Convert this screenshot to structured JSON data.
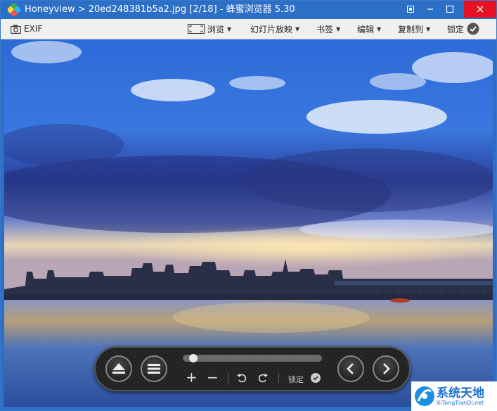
{
  "window": {
    "title": "Honeyview > 20ed248381b5a2.jpg [2/18] - 蜂蜜浏览器 5.30"
  },
  "menubar": {
    "exif_label": "EXIF",
    "browse_label": "浏览",
    "slideshow_label": "幻灯片放映",
    "bookmark_label": "书签",
    "edit_label": "编辑",
    "copy_to_label": "复制到",
    "lock_label": "锁定"
  },
  "control_panel": {
    "lock_label": "锁定",
    "zoom_in": "+",
    "zoom_out": "−",
    "slider_progress": 0.05
  },
  "watermark": {
    "title": "系统天地",
    "subtitle": "XiTongTianDi.net"
  },
  "colors": {
    "titlebar": "#2b6fc6",
    "close_button": "#e81123",
    "menubar": "#f0f0f0"
  }
}
